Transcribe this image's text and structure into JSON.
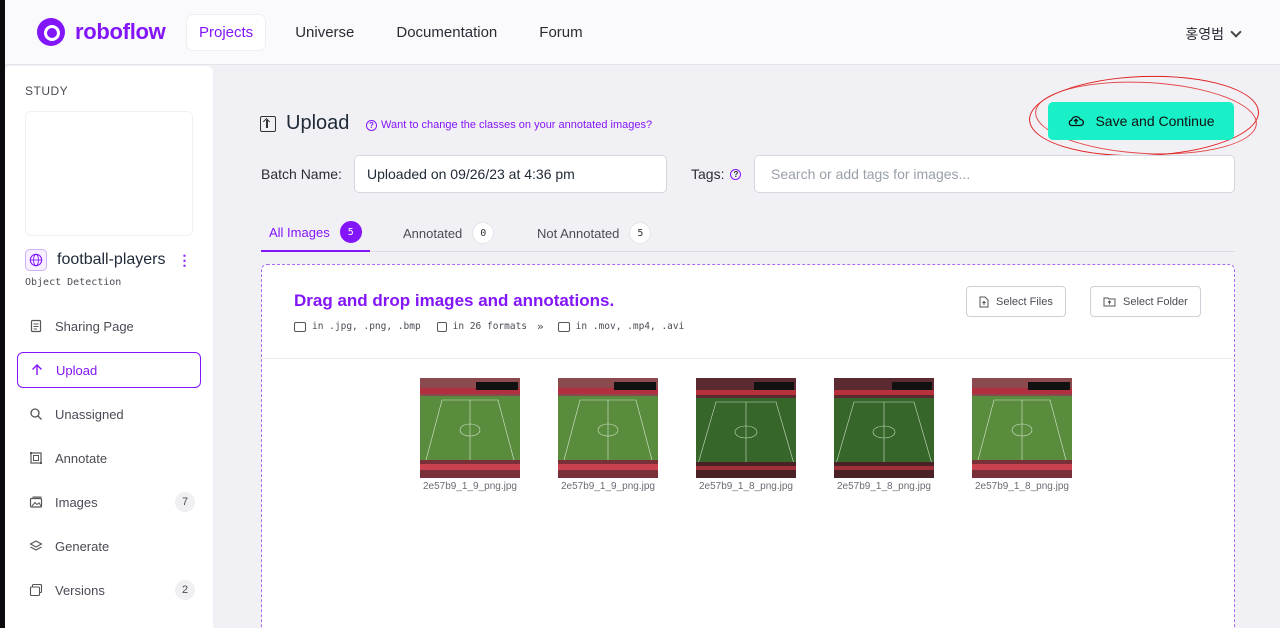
{
  "brand": {
    "name": "roboflow",
    "accent": "#8315f9",
    "cta_color": "#1af0c8"
  },
  "nav": {
    "items": [
      {
        "label": "Projects",
        "active": true
      },
      {
        "label": "Universe",
        "active": false
      },
      {
        "label": "Documentation",
        "active": false
      },
      {
        "label": "Forum",
        "active": false
      }
    ],
    "user": "홍영범"
  },
  "sidebar": {
    "section_label": "STUDY",
    "project_name": "football-players",
    "project_type": "Object Detection",
    "items": [
      {
        "label": "Sharing Page",
        "icon": "document-icon",
        "badge": null,
        "active": false
      },
      {
        "label": "Upload",
        "icon": "arrow-up-icon",
        "badge": null,
        "active": true
      },
      {
        "label": "Unassigned",
        "icon": "search-icon",
        "badge": null,
        "active": false
      },
      {
        "label": "Annotate",
        "icon": "annotate-icon",
        "badge": null,
        "active": false
      },
      {
        "label": "Images",
        "icon": "images-icon",
        "badge": "7",
        "active": false
      },
      {
        "label": "Generate",
        "icon": "layers-icon",
        "badge": null,
        "active": false
      },
      {
        "label": "Versions",
        "icon": "versions-icon",
        "badge": "2",
        "active": false
      }
    ]
  },
  "upload": {
    "title": "Upload",
    "change_classes_link": "Want to change the classes on your annotated images?",
    "save_button": "Save and Continue",
    "batch_label": "Batch Name:",
    "batch_value": "Uploaded on 09/26/23 at 4:36 pm",
    "tags_label": "Tags:",
    "tags_placeholder": "Search or add tags for images...",
    "tabs": [
      {
        "label": "All Images",
        "count": "5",
        "active": true
      },
      {
        "label": "Annotated",
        "count": "0",
        "active": false
      },
      {
        "label": "Not Annotated",
        "count": "5",
        "active": false
      }
    ],
    "drop_title": "Drag and drop images and annotations.",
    "formats": {
      "images": "in .jpg, .png, .bmp",
      "annotations": "in 26 formats",
      "more": "»",
      "video": "in .mov, .mp4, .avi"
    },
    "select_files": "Select Files",
    "select_folder": "Select Folder",
    "images": [
      {
        "filename": "2e57b9_1_9_png.jpg",
        "tone": "light"
      },
      {
        "filename": "2e57b9_1_9_png.jpg",
        "tone": "light"
      },
      {
        "filename": "2e57b9_1_8_png.jpg",
        "tone": "dark"
      },
      {
        "filename": "2e57b9_1_8_png.jpg",
        "tone": "dark"
      },
      {
        "filename": "2e57b9_1_8_png.jpg",
        "tone": "light"
      }
    ]
  }
}
